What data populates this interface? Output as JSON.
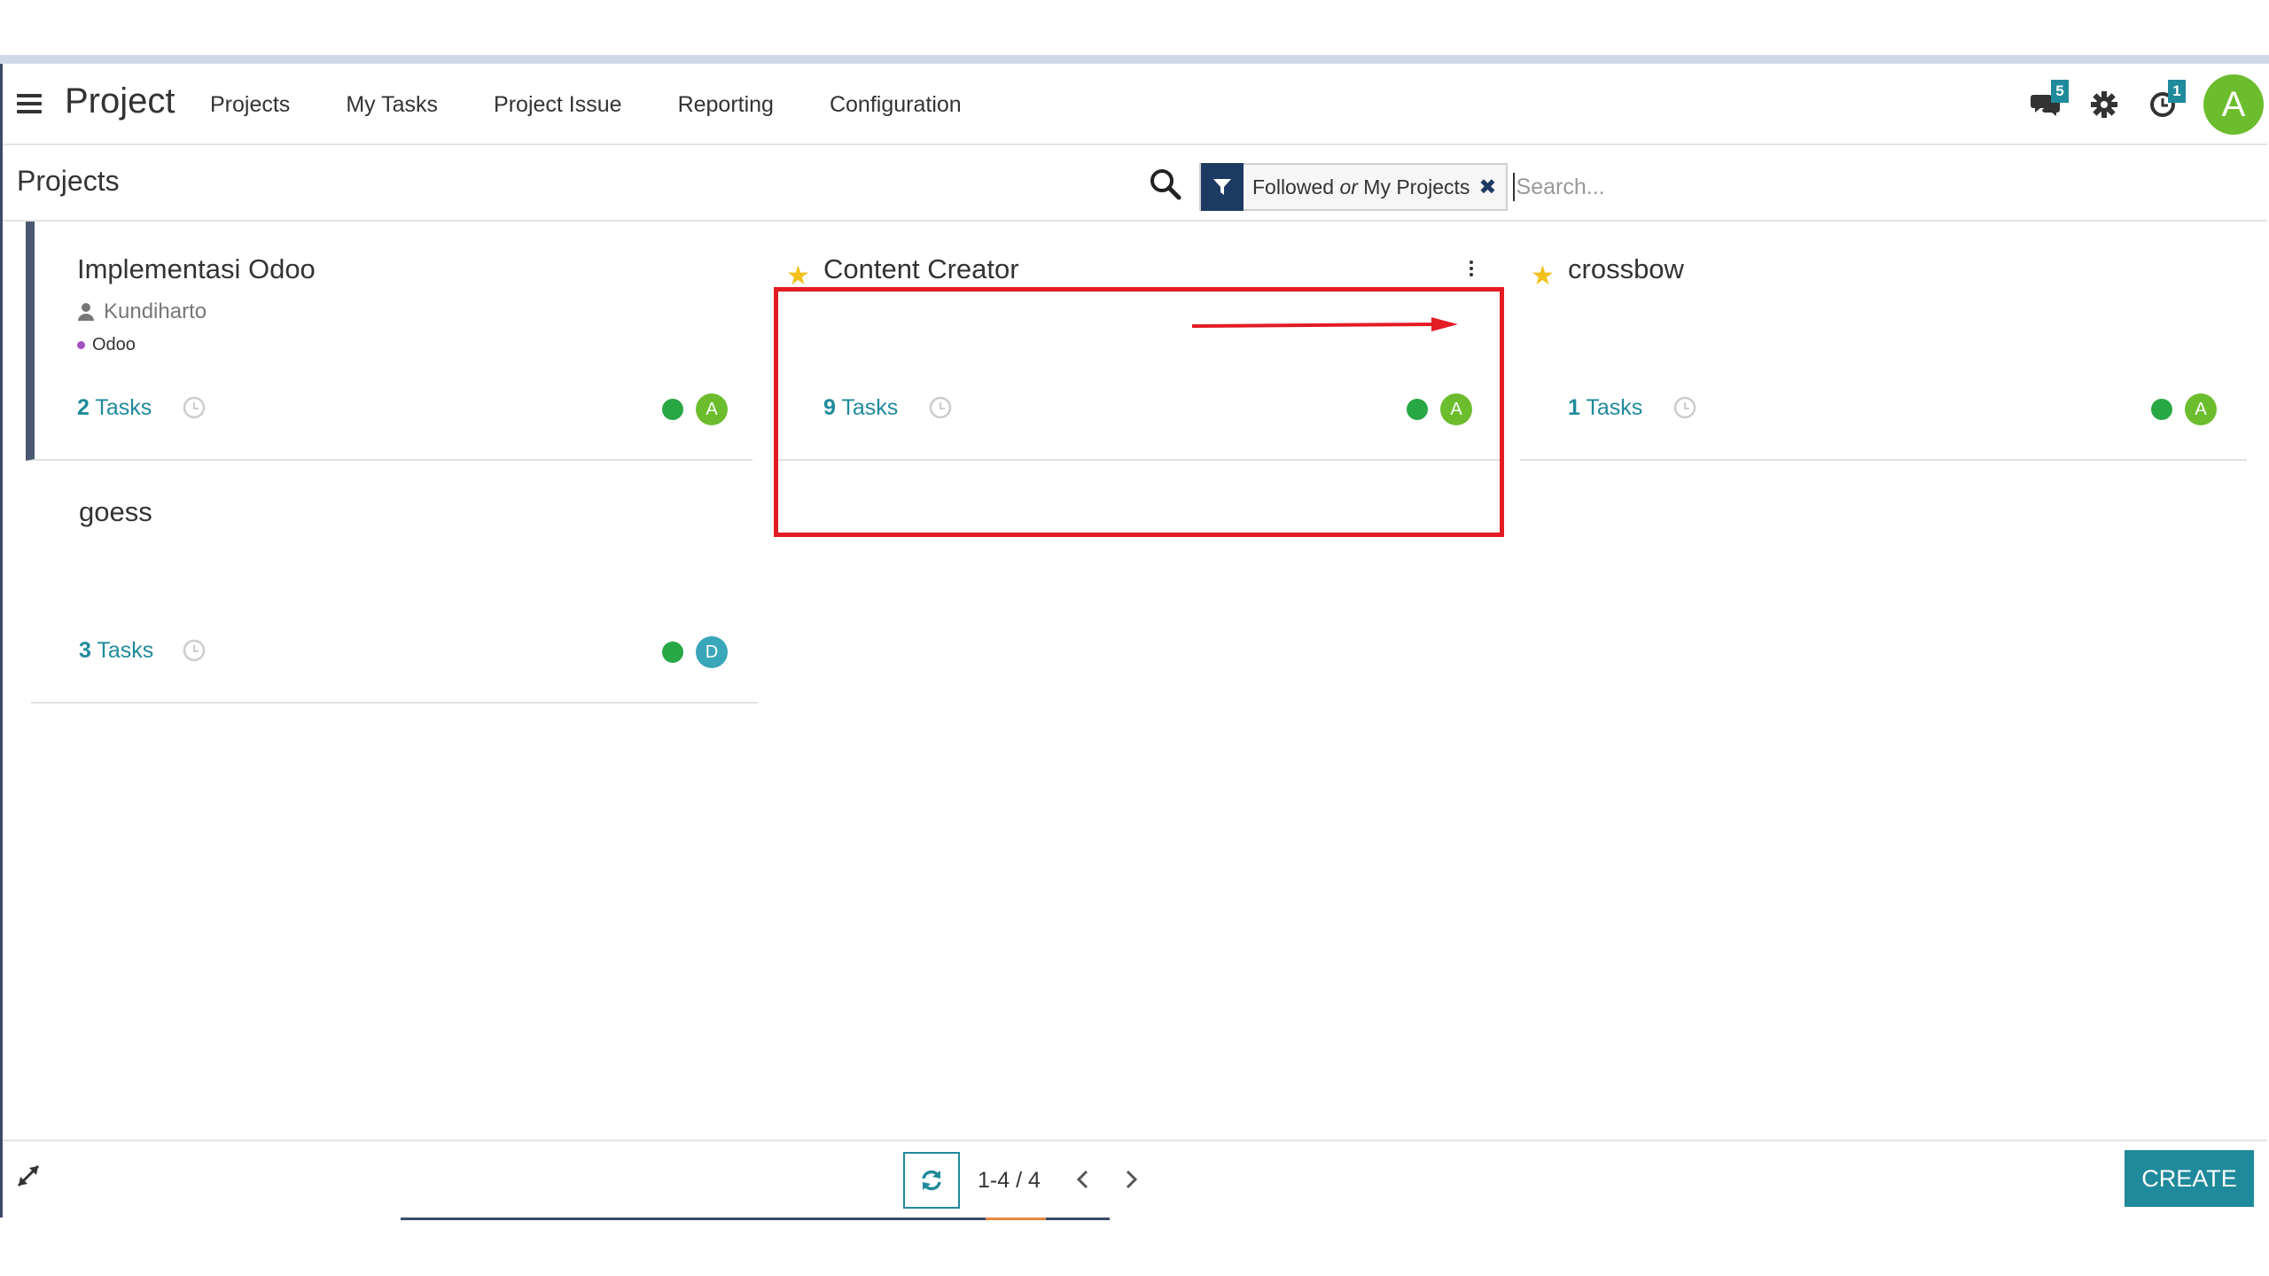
{
  "navbar": {
    "app_title": "Project",
    "menu": [
      "Projects",
      "My Tasks",
      "Project Issue",
      "Reporting",
      "Configuration"
    ],
    "messages_badge": "5",
    "activities_badge": "1",
    "user_initial": "A"
  },
  "control_panel": {
    "breadcrumb": "Projects",
    "facet": {
      "part1": "Followed",
      "or": "or",
      "part2": "My Projects"
    },
    "search_placeholder": "Search..."
  },
  "projects": [
    {
      "name": "Implementasi Odoo",
      "favorite": false,
      "manager": "Kundiharto",
      "tag": "Odoo",
      "task_count": "2",
      "task_label": "Tasks",
      "avatar": "A",
      "status_color": "#28a745"
    },
    {
      "name": "Content Creator",
      "favorite": true,
      "task_count": "9",
      "task_label": "Tasks",
      "avatar": "A",
      "status_color": "#28a745"
    },
    {
      "name": "crossbow",
      "favorite": true,
      "task_count": "1",
      "task_label": "Tasks",
      "avatar": "A",
      "status_color": "#28a745"
    },
    {
      "name": "goess",
      "favorite": false,
      "task_count": "3",
      "task_label": "Tasks",
      "avatar": "D",
      "status_color": "#28a745"
    }
  ],
  "pager": {
    "value": "1-4 / 4"
  },
  "create_label": "CREATE",
  "colors": {
    "accent": "#1f8a9b",
    "highlight": "#e31b23",
    "star": "#f3c11b"
  }
}
